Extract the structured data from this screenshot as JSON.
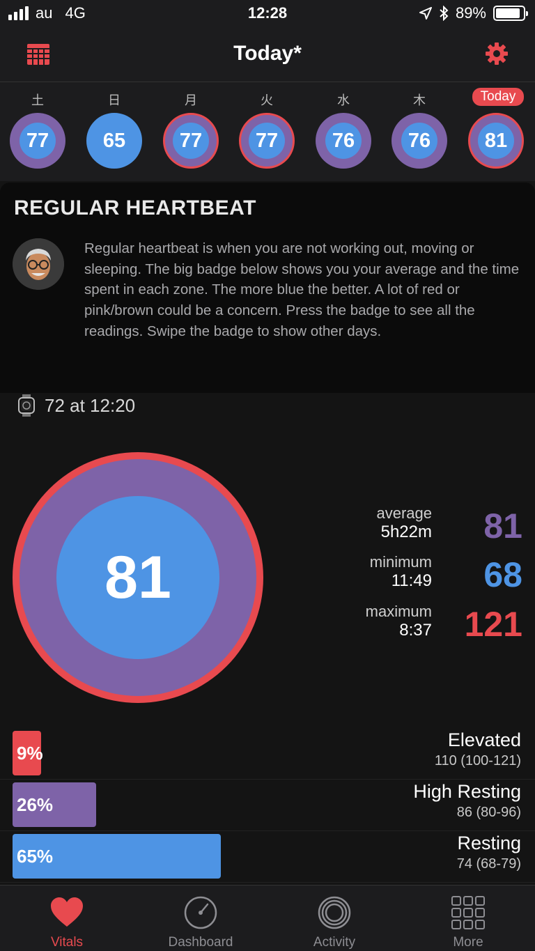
{
  "status_bar": {
    "carrier": "au",
    "network": "4G",
    "time": "12:28",
    "battery": "89%",
    "battery_level": 0.89
  },
  "nav": {
    "title": "Today*",
    "calendar_icon": "calendar-grid-icon",
    "settings_icon": "gear-icon"
  },
  "week": [
    {
      "label": "土",
      "value": "77"
    },
    {
      "label": "日",
      "value": "65"
    },
    {
      "label": "月",
      "value": "77"
    },
    {
      "label": "火",
      "value": "77"
    },
    {
      "label": "水",
      "value": "76"
    },
    {
      "label": "木",
      "value": "76"
    },
    {
      "label": "Today",
      "value": "81"
    }
  ],
  "info": {
    "title": "REGULAR HEARTBEAT",
    "text": "Regular heartbeat is when you are not working out, moving or sleeping. The big badge below shows you your average and the time spent in each zone. The more blue the better. A lot of red or pink/brown could be a concern. Press the badge to see all the readings. Swipe the badge to show other days."
  },
  "latest": {
    "text": "72 at 12:20"
  },
  "badge": {
    "value": "81"
  },
  "stats": {
    "average": {
      "label": "average",
      "sub": "5h22m",
      "value": "81",
      "color": "#7e63a8"
    },
    "minimum": {
      "label": "minimum",
      "sub": "11:49",
      "value": "68",
      "color": "#4e94e4"
    },
    "maximum": {
      "label": "maximum",
      "sub": "8:37",
      "value": "121",
      "color": "#e84a4f"
    }
  },
  "zones": [
    {
      "percent": "9%",
      "fraction": 0.09,
      "name": "Elevated",
      "range": "110 (100-121)",
      "color": "#e84a4f"
    },
    {
      "percent": "26%",
      "fraction": 0.26,
      "name": "High Resting",
      "range": "86 (80-96)",
      "color": "#7e63a8"
    },
    {
      "percent": "65%",
      "fraction": 0.65,
      "name": "Resting",
      "range": "74 (68-79)",
      "color": "#4e94e4"
    }
  ],
  "tabs": [
    {
      "label": "Vitals",
      "icon": "heart-icon",
      "active": true
    },
    {
      "label": "Dashboard",
      "icon": "gauge-icon",
      "active": false
    },
    {
      "label": "Activity",
      "icon": "rings-icon",
      "active": false
    },
    {
      "label": "More",
      "icon": "grid-icon",
      "active": false
    }
  ],
  "colors": {
    "red": "#e84a4f",
    "purple": "#7e63a8",
    "blue": "#4e94e4"
  }
}
